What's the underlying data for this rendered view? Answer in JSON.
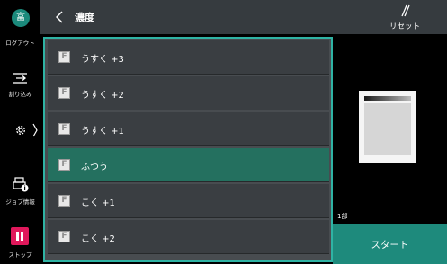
{
  "sidebar": {
    "logout": {
      "icon_char": "富",
      "label": "ログアウト"
    },
    "interrupt": {
      "label": "割り込み"
    },
    "job_info": {
      "label": "ジョブ情報"
    },
    "stop": {
      "label": "ストップ"
    }
  },
  "header": {
    "title": "濃度",
    "reset_label": "リセット"
  },
  "density_list": {
    "items": [
      {
        "label": "うすく +3",
        "selected": false
      },
      {
        "label": "うすく +2",
        "selected": false
      },
      {
        "label": "うすく +1",
        "selected": false
      },
      {
        "label": "ふつう",
        "selected": true
      },
      {
        "label": "こく +1",
        "selected": false
      },
      {
        "label": "こく +2",
        "selected": false
      }
    ],
    "item_icon": "F"
  },
  "preview": {
    "copies_label": "1部"
  },
  "start_button": {
    "label": "スタート"
  },
  "colors": {
    "accent": "#2fb3a4",
    "selected_row": "#24705f",
    "start": "#1e8a7c",
    "stop": "#e0185b"
  }
}
